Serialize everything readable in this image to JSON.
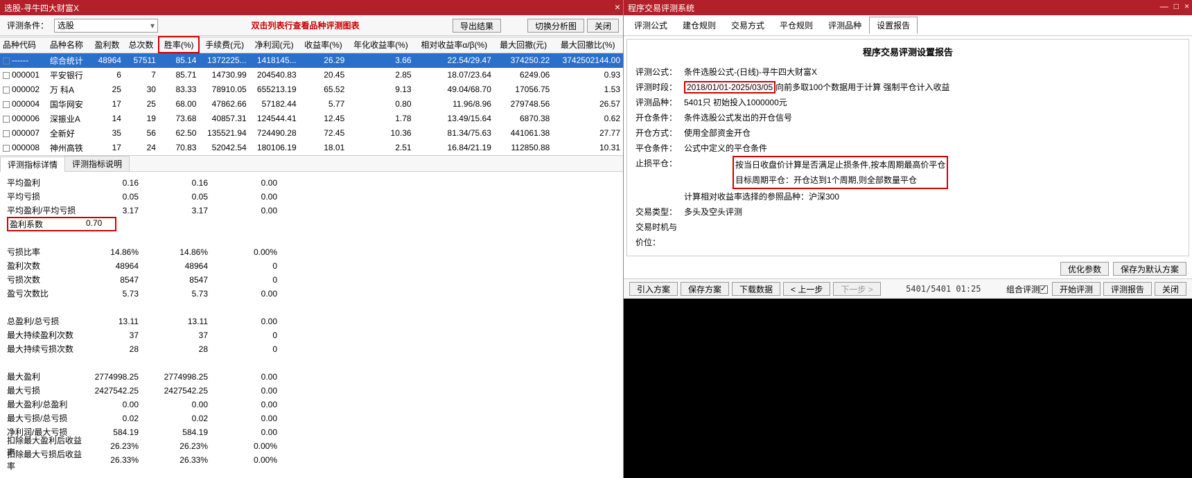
{
  "left": {
    "title": "选股-寻牛四大财富X",
    "cond_label": "评测条件：",
    "combo_value": "选股",
    "red_message": "双击列表行查看品种评测图表",
    "btn_export": "导出结果",
    "btn_switch": "切换分析图",
    "btn_close": "关闭",
    "columns": [
      "品种代码",
      "品种名称",
      "盈利数",
      "总次数",
      "胜率(%)",
      "手续费(元)",
      "净利润(元)",
      "收益率(%)",
      "年化收益率(%)",
      "相对收益率α/β(%)",
      "最大回撤(元)",
      "最大回撤比(%)"
    ],
    "rows": [
      {
        "code": "------",
        "name": "综合统计",
        "c": [
          "48964",
          "57511",
          "85.14",
          "1372225...",
          "1418145...",
          "26.29",
          "3.66",
          "22.54/29.47",
          "374250.22",
          "3742502144.00"
        ],
        "sel": true
      },
      {
        "code": "000001",
        "name": "平安银行",
        "c": [
          "6",
          "7",
          "85.71",
          "14730.99",
          "204540.83",
          "20.45",
          "2.85",
          "18.07/23.64",
          "6249.06",
          "0.93"
        ]
      },
      {
        "code": "000002",
        "name": "万 科A",
        "c": [
          "25",
          "30",
          "83.33",
          "78910.05",
          "655213.19",
          "65.52",
          "9.13",
          "49.04/68.70",
          "17056.75",
          "1.53"
        ]
      },
      {
        "code": "000004",
        "name": "国华网安",
        "c": [
          "17",
          "25",
          "68.00",
          "47862.66",
          "57182.44",
          "5.77",
          "0.80",
          "11.96/8.96",
          "279748.56",
          "26.57"
        ]
      },
      {
        "code": "000006",
        "name": "深振业A",
        "c": [
          "14",
          "19",
          "73.68",
          "40857.31",
          "124544.41",
          "12.45",
          "1.78",
          "13.49/15.64",
          "6870.38",
          "0.62"
        ]
      },
      {
        "code": "000007",
        "name": "全新好",
        "c": [
          "35",
          "56",
          "62.50",
          "135521.94",
          "724490.28",
          "72.45",
          "10.36",
          "81.34/75.63",
          "441061.38",
          "27.77"
        ]
      },
      {
        "code": "000008",
        "name": "神州高铁",
        "c": [
          "17",
          "24",
          "70.83",
          "52042.54",
          "180106.19",
          "18.01",
          "2.51",
          "16.84/21.19",
          "112850.88",
          "10.31"
        ]
      }
    ],
    "tab_detail": "评测指标详情",
    "tab_desc": "评测指标说明",
    "metrics": [
      {
        "l": "平均盈利",
        "v1": "0.16",
        "v2": "0.16",
        "v3": "0.00"
      },
      {
        "l": "平均亏损",
        "v1": "0.05",
        "v2": "0.05",
        "v3": "0.00"
      },
      {
        "l": "平均盈利/平均亏损",
        "v1": "3.17",
        "v2": "3.17",
        "v3": "0.00"
      },
      {
        "l": "盈利系数",
        "v1": "0.70",
        "v2": "",
        "v3": "",
        "hl": true
      },
      {
        "l": "",
        "v1": "",
        "v2": "",
        "v3": ""
      },
      {
        "l": "亏损比率",
        "v1": "14.86%",
        "v2": "14.86%",
        "v3": "0.00%"
      },
      {
        "l": "盈利次数",
        "v1": "48964",
        "v2": "48964",
        "v3": "0"
      },
      {
        "l": "亏损次数",
        "v1": "8547",
        "v2": "8547",
        "v3": "0"
      },
      {
        "l": "盈亏次数比",
        "v1": "5.73",
        "v2": "5.73",
        "v3": "0.00"
      },
      {
        "l": "",
        "v1": "",
        "v2": "",
        "v3": ""
      },
      {
        "l": "总盈利/总亏损",
        "v1": "13.11",
        "v2": "13.11",
        "v3": "0.00"
      },
      {
        "l": "最大持续盈利次数",
        "v1": "37",
        "v2": "37",
        "v3": "0"
      },
      {
        "l": "最大持续亏损次数",
        "v1": "28",
        "v2": "28",
        "v3": "0"
      },
      {
        "l": "",
        "v1": "",
        "v2": "",
        "v3": ""
      },
      {
        "l": "最大盈利",
        "v1": "2774998.25",
        "v2": "2774998.25",
        "v3": "0.00"
      },
      {
        "l": "最大亏损",
        "v1": "2427542.25",
        "v2": "2427542.25",
        "v3": "0.00"
      },
      {
        "l": "最大盈利/总盈利",
        "v1": "0.00",
        "v2": "0.00",
        "v3": "0.00"
      },
      {
        "l": "最大亏损/总亏损",
        "v1": "0.02",
        "v2": "0.02",
        "v3": "0.00"
      },
      {
        "l": "净利润/最大亏损",
        "v1": "584.19",
        "v2": "584.19",
        "v3": "0.00"
      },
      {
        "l": "扣除最大盈利后收益率",
        "v1": "26.23%",
        "v2": "26.23%",
        "v3": "0.00%"
      },
      {
        "l": "扣除最大亏损后收益率",
        "v1": "26.33%",
        "v2": "26.33%",
        "v3": "0.00%"
      }
    ]
  },
  "right": {
    "title": "程序交易评测系统",
    "tabs": [
      "评测公式",
      "建仓规则",
      "交易方式",
      "平仓规则",
      "评测品种",
      "设置报告"
    ],
    "active_tab": 5,
    "report_title": "程序交易评测设置报告",
    "lines": [
      {
        "k": "评测公式：",
        "v": "条件选股公式-(日线)-寻牛四大财富X"
      },
      {
        "k": "评测时段：",
        "v": "2018/01/01-2025/03/05",
        "suffix": "向前多取100个数据用于计算 强制平仓计入收益",
        "hl": true
      },
      {
        "k": "评测品种：",
        "v": "5401只 初始投入1000000元"
      },
      {
        "k": "开仓条件：",
        "v": "条件选股公式发出的开仓信号"
      },
      {
        "k": "开仓方式：",
        "v": "使用全部资金开仓"
      },
      {
        "k": "平仓条件：",
        "v": "公式中定义的平仓条件"
      },
      {
        "k": "止损平仓：",
        "v": "按当日收盘价计算是否满足止损条件,按本周期最高价平仓",
        "hl2": true
      },
      {
        "k": "",
        "v": "目标周期平仓：开仓达到1个周期,则全部数量平仓",
        "hl2": true
      },
      {
        "k": "",
        "v": "计算相对收益率选择的参照品种：沪深300"
      },
      {
        "k": "",
        "v": ""
      },
      {
        "k": "交易类型：",
        "v": "多头及空头评测"
      },
      {
        "k": "交易时机与价位：",
        "v": ""
      }
    ],
    "btn_opt": "优化参数",
    "btn_save_default": "保存为默认方案",
    "btns2": {
      "import": "引入方案",
      "save": "保存方案",
      "download": "下载数据",
      "prev": "< 上一步",
      "next": "下一步 >",
      "combo": "组合评测",
      "start": "开始评测",
      "report": "评测报告",
      "close": "关闭"
    },
    "status": "5401/5401 01:25",
    "combo_checked": true
  }
}
